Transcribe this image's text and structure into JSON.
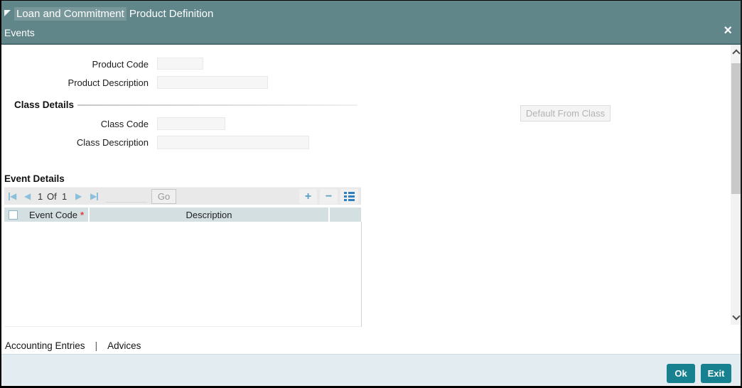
{
  "header": {
    "title_part1": "Loan and Commitment",
    "title_part2": "Product Definition",
    "subtitle": "Events",
    "close_icon": "×"
  },
  "form": {
    "product_code_label": "Product Code",
    "product_code_value": "",
    "product_description_label": "Product Description",
    "product_description_value": ""
  },
  "class_details": {
    "heading": "Class Details",
    "class_code_label": "Class Code",
    "class_code_value": "",
    "class_description_label": "Class Description",
    "class_description_value": "",
    "default_button": "Default From Class"
  },
  "event_details": {
    "heading": "Event Details",
    "pagination": {
      "current": "1",
      "of_label": "Of",
      "total": "1",
      "goto_value": "",
      "go_button": "Go"
    },
    "add_icon": "+",
    "remove_icon": "−",
    "table": {
      "columns": [
        {
          "label": "Event Code",
          "required_marker": "*"
        },
        {
          "label": "Description"
        }
      ],
      "rows": []
    }
  },
  "links": {
    "accounting_entries": "Accounting Entries",
    "separator": "|",
    "advices": "Advices"
  },
  "footer": {
    "ok_button": "Ok",
    "exit_button": "Exit"
  },
  "colors": {
    "header_teal": "#61868a",
    "button_teal": "#17818f",
    "table_header": "#d3dfe1",
    "footer_bg": "#e3edf1",
    "pagination_blue": "#8bc0dc",
    "details_icon_blue": "#2d7fc0",
    "required_red": "#e03c3c"
  }
}
